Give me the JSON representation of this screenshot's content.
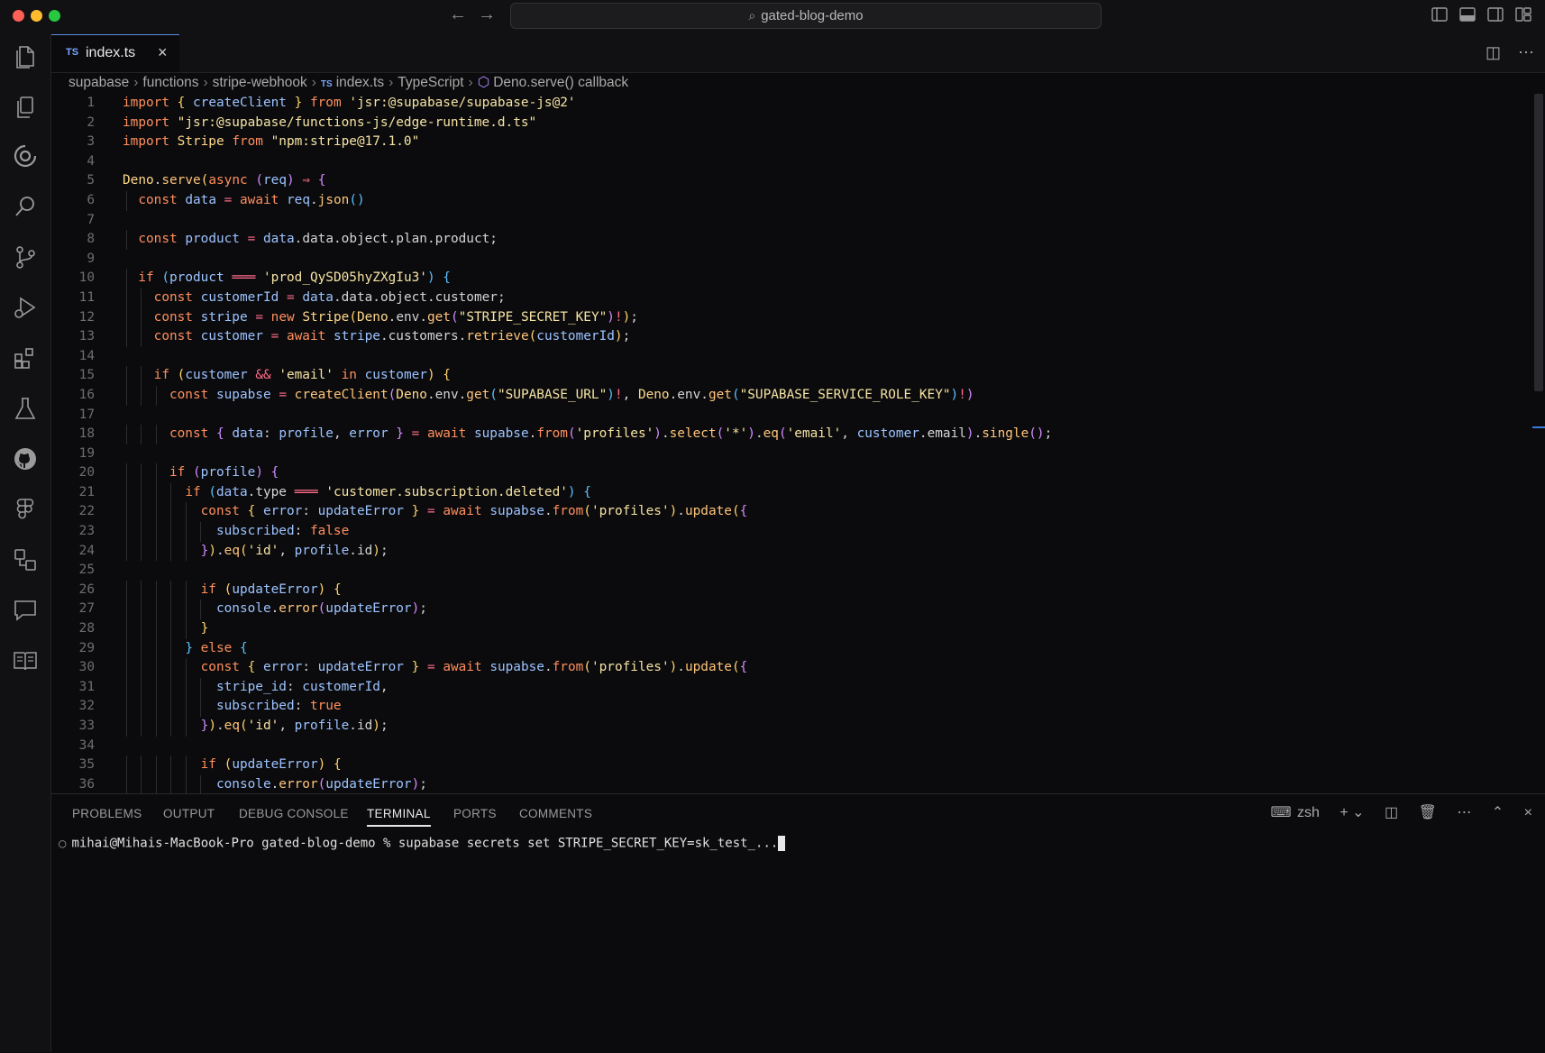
{
  "window": {
    "search_text": "gated-blog-demo"
  },
  "tabs": [
    {
      "label": "index.ts",
      "lang_badge": "TS"
    }
  ],
  "breadcrumb": {
    "items": [
      "supabase",
      "functions",
      "stripe-webhook",
      "index.ts",
      "TypeScript",
      "Deno.serve() callback"
    ],
    "lang_badge": "TS"
  },
  "activity_bar": {
    "icons": [
      "explorer-icon",
      "copy-icon",
      "timeline-icon",
      "search-icon",
      "source-control-icon",
      "run-debug-icon",
      "extensions-icon",
      "testing-icon",
      "github-icon",
      "figma-icon",
      "remote-icon",
      "chat-icon",
      "book-icon"
    ]
  },
  "code": {
    "lines": [
      "import { createClient } from 'jsr:@supabase/supabase-js@2'",
      "import \"jsr:@supabase/functions-js/edge-runtime.d.ts\"",
      "import Stripe from \"npm:stripe@17.1.0\"",
      "",
      "Deno.serve(async (req) ⇒ {",
      "  const data = await req.json()",
      "",
      "  const product = data.data.object.plan.product;",
      "",
      "  if (product ═══ 'prod_QySD05hyZXgIu3') {",
      "    const customerId = data.data.object.customer;",
      "    const stripe = new Stripe(Deno.env.get(\"STRIPE_SECRET_KEY\")!);",
      "    const customer = await stripe.customers.retrieve(customerId);",
      "",
      "    if (customer && 'email' in customer) {",
      "      const supabse = createClient(Deno.env.get(\"SUPABASE_URL\")!, Deno.env.get(\"SUPABASE_SERVICE_ROLE_KEY\")!)",
      "",
      "      const { data: profile, error } = await supabse.from('profiles').select('*').eq('email', customer.email).single();",
      "",
      "      if (profile) {",
      "        if (data.type ═══ 'customer.subscription.deleted') {",
      "          const { error: updateError } = await supabse.from('profiles').update({",
      "            subscribed: false",
      "          }).eq('id', profile.id);",
      "",
      "          if (updateError) {",
      "            console.error(updateError);",
      "          }",
      "        } else {",
      "          const { error: updateError } = await supabse.from('profiles').update({",
      "            stripe_id: customerId,",
      "            subscribed: true",
      "          }).eq('id', profile.id);",
      "",
      "          if (updateError) {",
      "            console.error(updateError);"
    ]
  },
  "panel": {
    "tabs": [
      "PROBLEMS",
      "OUTPUT",
      "DEBUG CONSOLE",
      "TERMINAL",
      "PORTS",
      "COMMENTS"
    ],
    "active_tab": "TERMINAL",
    "shell_label": "zsh",
    "terminal": {
      "prompt": "mihai@Mihais-MacBook-Pro gated-blog-demo % ",
      "command": "supabase secrets set STRIPE_SECRET_KEY=sk_test_..."
    }
  }
}
